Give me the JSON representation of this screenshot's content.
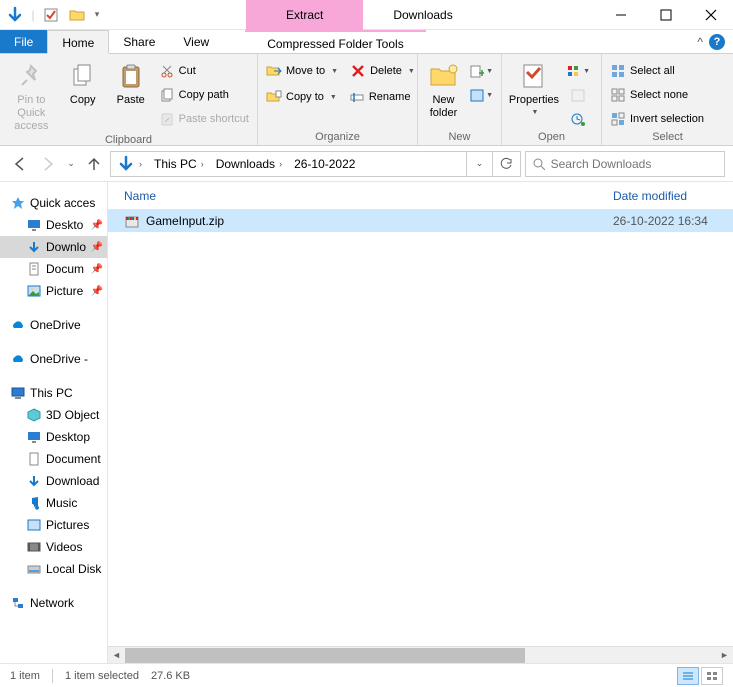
{
  "window": {
    "contextual_tab": "Extract",
    "title": "Downloads"
  },
  "tabs": {
    "file": "File",
    "home": "Home",
    "share": "Share",
    "view": "View",
    "contextual": "Compressed Folder Tools"
  },
  "ribbon": {
    "clipboard": {
      "label": "Clipboard",
      "pin": "Pin to Quick access",
      "copy": "Copy",
      "paste": "Paste",
      "cut": "Cut",
      "copy_path": "Copy path",
      "paste_shortcut": "Paste shortcut"
    },
    "organize": {
      "label": "Organize",
      "move_to": "Move to",
      "copy_to": "Copy to",
      "delete": "Delete",
      "rename": "Rename"
    },
    "new_group": {
      "label": "New",
      "new_folder": "New folder"
    },
    "open": {
      "label": "Open",
      "properties": "Properties"
    },
    "select": {
      "label": "Select",
      "select_all": "Select all",
      "select_none": "Select none",
      "invert": "Invert selection"
    }
  },
  "breadcrumb": {
    "seg1": "This PC",
    "seg2": "Downloads",
    "seg3": "26-10-2022"
  },
  "search": {
    "placeholder": "Search Downloads"
  },
  "sidebar": {
    "quick_access": "Quick acces",
    "desktop": "Deskto",
    "downloads": "Downlo",
    "documents": "Docum",
    "pictures": "Picture",
    "onedrive1": "OneDrive",
    "onedrive2": "OneDrive -",
    "this_pc": "This PC",
    "objects3d": "3D Object",
    "desktop2": "Desktop",
    "documents2": "Document",
    "downloads2": "Download",
    "music": "Music",
    "pictures2": "Pictures",
    "videos": "Videos",
    "local_disk": "Local Disk",
    "network": "Network"
  },
  "columns": {
    "name": "Name",
    "date": "Date modified"
  },
  "files": [
    {
      "name": "GameInput.zip",
      "date": "26-10-2022 16:34"
    }
  ],
  "status": {
    "count": "1 item",
    "selected": "1 item selected",
    "size": "27.6 KB"
  }
}
